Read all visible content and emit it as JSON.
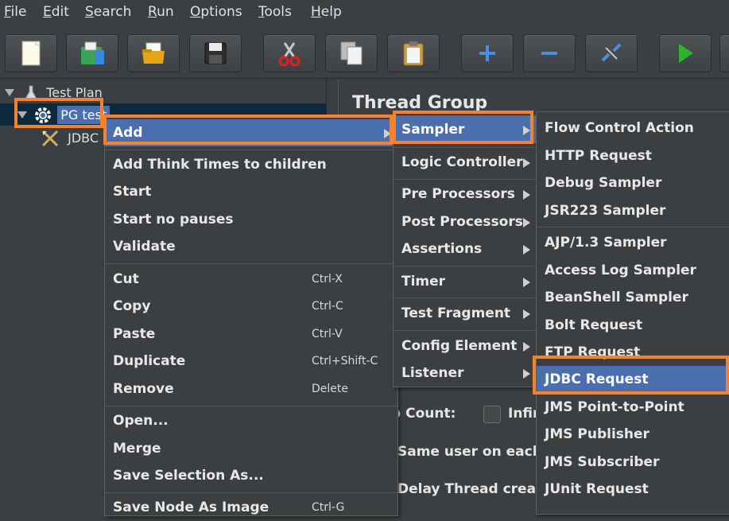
{
  "menubar": {
    "items": [
      {
        "first": "F",
        "rest": "ile"
      },
      {
        "first": "E",
        "rest": "dit"
      },
      {
        "first": "S",
        "rest": "earch"
      },
      {
        "first": "R",
        "rest": "un"
      },
      {
        "first": "O",
        "rest": "ptions"
      },
      {
        "first": "T",
        "rest": "ools"
      },
      {
        "first": "H",
        "rest": "elp"
      }
    ]
  },
  "tree": {
    "test_plan": "Test Plan",
    "thread_group": "PG test",
    "jdbc_child": "JDBC"
  },
  "right_panel": {
    "title": "Thread Group",
    "loop_count": "p Count:",
    "infinite": "Infin",
    "same_user": "Same user on each",
    "delay": "Delay Thread creatio"
  },
  "context_menu": {
    "add": "Add",
    "add_think_times": "Add Think Times to children",
    "start": "Start",
    "start_no_pauses": "Start no pauses",
    "validate": "Validate",
    "cut": "Cut",
    "cut_acc": "Ctrl-X",
    "copy": "Copy",
    "copy_acc": "Ctrl-C",
    "paste": "Paste",
    "paste_acc": "Ctrl-V",
    "duplicate": "Duplicate",
    "duplicate_acc": "Ctrl+Shift-C",
    "remove": "Remove",
    "remove_acc": "Delete",
    "open": "Open...",
    "merge": "Merge",
    "save_selection": "Save Selection As...",
    "save_node_image": "Save Node As Image",
    "save_node_image_acc": "Ctrl-G"
  },
  "add_menu": {
    "sampler": "Sampler",
    "logic_controller": "Logic Controller",
    "pre_processors": "Pre Processors",
    "post_processors": "Post Processors",
    "assertions": "Assertions",
    "timer": "Timer",
    "test_fragment": "Test Fragment",
    "config_element": "Config Element",
    "listener": "Listener"
  },
  "sampler_menu": {
    "flow_control_action": "Flow Control Action",
    "http_request": "HTTP Request",
    "debug_sampler": "Debug Sampler",
    "jsr223_sampler": "JSR223 Sampler",
    "ajp_sampler": "AJP/1.3 Sampler",
    "access_log_sampler": "Access Log Sampler",
    "beanshell_sampler": "BeanShell Sampler",
    "bolt_request": "Bolt Request",
    "ftp_request": "FTP Request",
    "jdbc_request": "JDBC Request",
    "jms_point_to_point": "JMS Point-to-Point",
    "jms_publisher": "JMS Publisher",
    "jms_subscriber": "JMS Subscriber",
    "junit_request": "JUnit Request"
  },
  "colors": {
    "highlight": "#4b6eaf",
    "callout": "#f7822e",
    "background": "#3c3f41"
  }
}
